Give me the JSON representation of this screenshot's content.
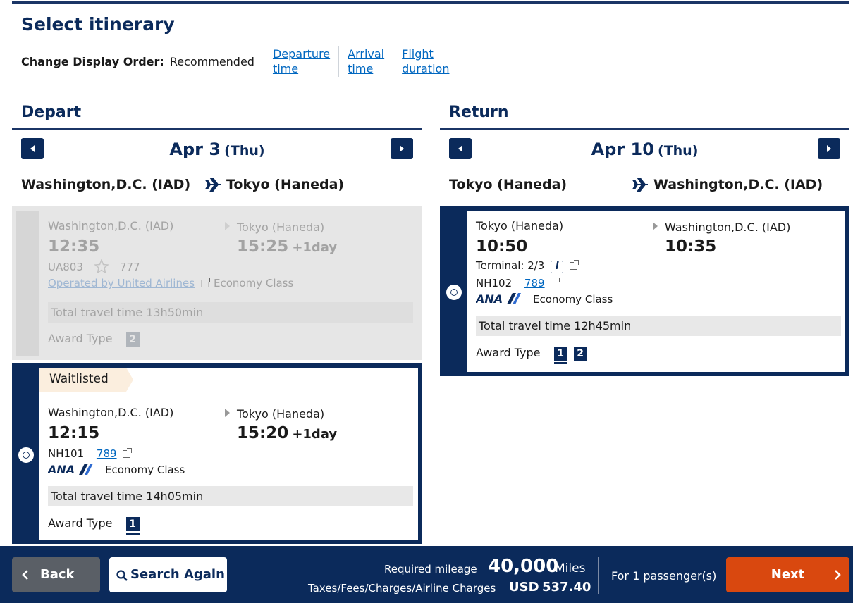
{
  "page": {
    "title": "Select itinerary"
  },
  "display_order": {
    "label": "Change Display Order:",
    "current": "Recommended",
    "options": [
      {
        "line1": "Departure",
        "line2": "time"
      },
      {
        "line1": "Arrival",
        "line2": "time"
      },
      {
        "line1": "Flight",
        "line2": "duration"
      }
    ]
  },
  "depart": {
    "title": "Depart",
    "date": "Apr 3",
    "dow": "(Thu)",
    "from": "Washington,D.C. (IAD)",
    "to": "Tokyo (Haneda)",
    "flights": [
      {
        "status": "unavailable",
        "from_city": "Washington,D.C. (IAD)",
        "dep_time": "12:35",
        "to_city": "Tokyo (Haneda)",
        "arr_time": "15:25",
        "arr_offset": "+1day",
        "flight_no": "UA803",
        "aircraft": "777",
        "operator": "Operated by United Airlines",
        "cabin": "Economy Class",
        "travel_time": "Total travel time 13h50min",
        "award_label": "Award Type",
        "award_types": [
          "2"
        ]
      },
      {
        "status": "selected",
        "tag": "Waitlisted",
        "from_city": "Washington,D.C. (IAD)",
        "dep_time": "12:15",
        "to_city": "Tokyo (Haneda)",
        "arr_time": "15:20",
        "arr_offset": "+1day",
        "flight_no": "NH101",
        "aircraft": "789",
        "airline": "ANA",
        "cabin": "Economy Class",
        "travel_time": "Total travel time 14h05min",
        "award_label": "Award Type",
        "award_types": [
          "1"
        ]
      }
    ]
  },
  "return": {
    "title": "Return",
    "date": "Apr 10",
    "dow": "(Thu)",
    "from": "Tokyo (Haneda)",
    "to": "Washington,D.C. (IAD)",
    "flights": [
      {
        "status": "selected",
        "from_city": "Tokyo (Haneda)",
        "dep_time": "10:50",
        "terminal": "Terminal: 2/3",
        "to_city": "Washington,D.C. (IAD)",
        "arr_time": "10:35",
        "flight_no": "NH102",
        "aircraft": "789",
        "airline": "ANA",
        "cabin": "Economy Class",
        "travel_time": "Total travel time 12h45min",
        "award_label": "Award Type",
        "award_types": [
          "1",
          "2"
        ]
      }
    ]
  },
  "footer": {
    "back": "Back",
    "search_again": "Search Again",
    "mileage_label": "Required mileage",
    "mileage_value": "40,000",
    "mileage_unit": "Miles",
    "taxes_label": "Taxes/Fees/Charges/Airline Charges",
    "currency": "USD",
    "taxes_value": "537.40",
    "passengers": "For 1 passenger(s)",
    "next": "Next"
  },
  "colors": {
    "navy": "#0b2a5b",
    "link": "#0067c0",
    "next": "#d9480f",
    "waitlist_tag": "#fbeede"
  }
}
